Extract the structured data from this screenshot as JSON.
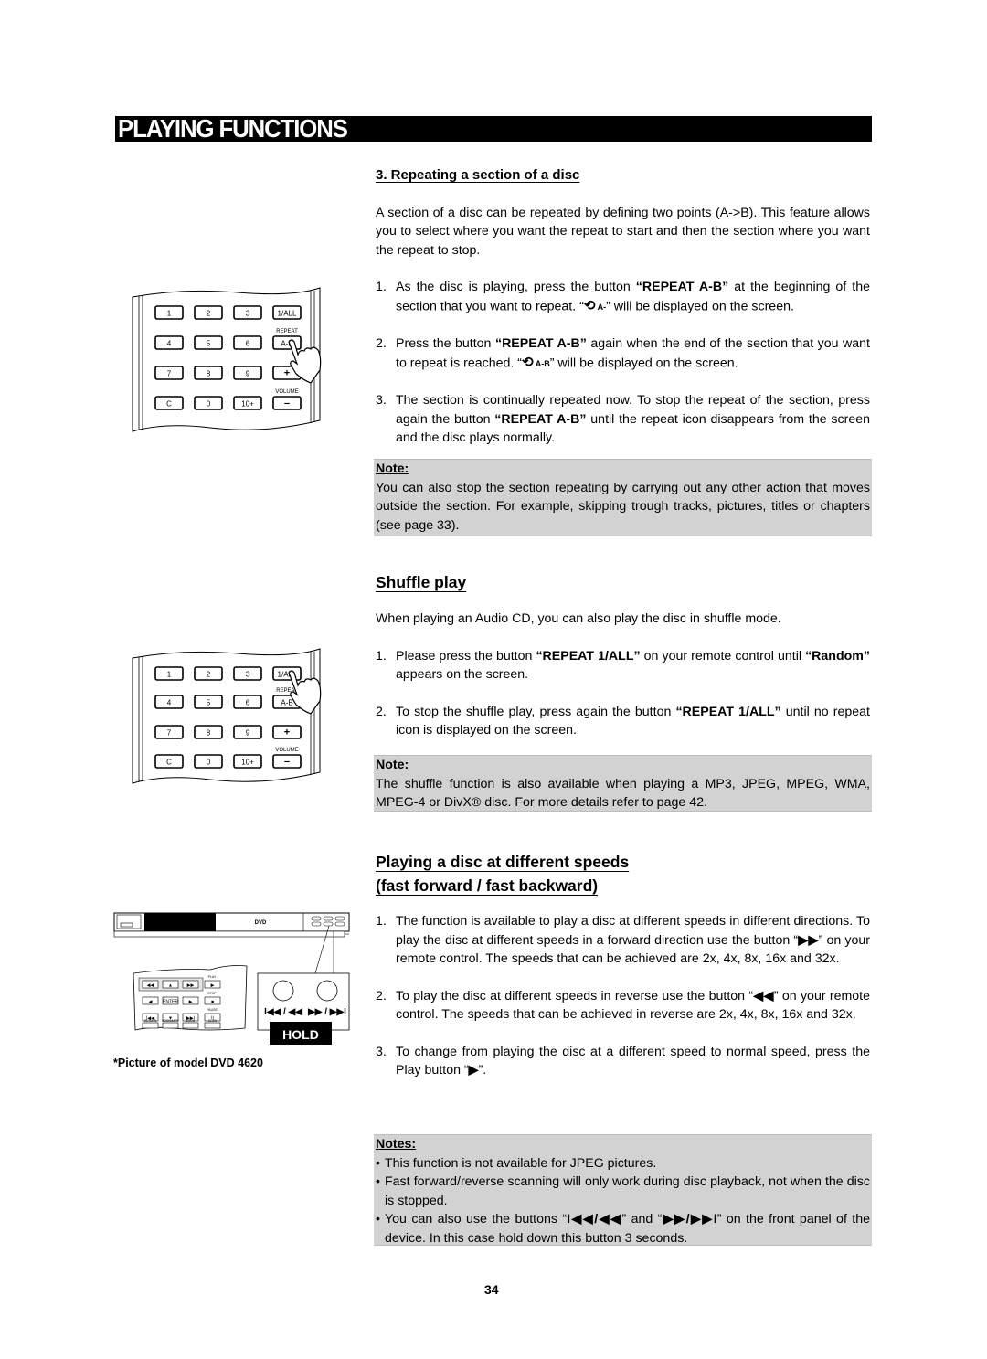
{
  "header": {
    "title": "PLAYING FUNCTIONS"
  },
  "section_repeat": {
    "heading": "3. Repeating a section of a disc",
    "intro": "A section of a disc can be repeated by defining two points (A->B). This feature allows you to select where you want the repeat to start and then the section where you want the repeat to stop.",
    "steps": [
      {
        "num": "1.",
        "pre": "As the disc is playing, press the button ",
        "bold": "“REPEAT A-B”",
        "post": " at the beginning of the section that you want to repeat. “",
        "icon_label": "A-",
        "tail": "” will be displayed on the screen."
      },
      {
        "num": "2.",
        "pre": "Press the button ",
        "bold": "“REPEAT A-B”",
        "post": " again when the end of the section that you want to repeat is reached. “",
        "icon_label": "A-B",
        "tail": "” will be displayed on the screen."
      },
      {
        "num": "3.",
        "pre": "The section is continually repeated now. To stop the repeat of the section, press again the button ",
        "bold": "“REPEAT A-B”",
        "post": " until the repeat icon disappears from the screen and the disc plays normally."
      }
    ],
    "repeat_icon": "repeat-icon",
    "note_label": "Note:",
    "note_text": "You can also stop the section repeating by carrying out any other action that moves outside the section. For example, skipping trough tracks, pictures, titles or chapters (see page 33)."
  },
  "section_shuffle": {
    "heading": "Shuffle play",
    "intro": "When playing an Audio CD, you can also play the disc in shuffle mode.",
    "steps": [
      {
        "num": "1.",
        "pre": "Please press the button ",
        "bold": "“REPEAT 1/ALL”",
        "post": " on your remote control until ",
        "bold2": "“Random”",
        "tail": " appears on the screen."
      },
      {
        "num": "2.",
        "pre": "To stop the shuffle play, press again the button ",
        "bold": "“REPEAT 1/ALL”",
        "post": " until no repeat icon is displayed on the screen."
      }
    ],
    "note_label": "Note:",
    "note_text": "The shuffle function is also available when playing a MP3, JPEG, MPEG, WMA, MPEG-4 or DivX® disc. For more details refer to page 42."
  },
  "section_speed": {
    "heading_line1": "Playing a disc at different speeds",
    "heading_line2": "(fast forward / fast backward)",
    "steps": [
      {
        "num": "1.",
        "pre": "The function is available to play a disc at different speeds in different directions. To play the disc at different speeds in a forward direction use the button “",
        "symbol": "▶▶",
        "post": "” on your remote control. The speeds that can be achieved are 2x, 4x, 8x, 16x and 32x."
      },
      {
        "num": "2.",
        "pre": "To play the disc at different speeds in reverse use the button “",
        "symbol": "◀◀",
        "post": "” on your remote control. The speeds that can be achieved in reverse are 2x, 4x, 8x, 16x and 32x."
      },
      {
        "num": "3.",
        "pre": "To change from playing the disc at a different speed to normal speed, press the Play button “",
        "symbol": "▶",
        "post": "”."
      }
    ],
    "notes_label": "Notes:",
    "notes": [
      "This function is not available for JPEG pictures.",
      "Fast forward/reverse scanning will only work during disc playback, not when the disc is stopped."
    ],
    "note3_pre": "You can also use the buttons “",
    "note3_sym1": "I◀◀/◀◀",
    "note3_mid": "” and “",
    "note3_sym2": "▶▶/▶▶I",
    "note3_post": "” on the front panel of the device. In this case hold down this button 3 seconds."
  },
  "remote_keypad": {
    "rows": [
      [
        "1",
        "2",
        "3",
        "1/ALL"
      ],
      [
        "4",
        "5",
        "6",
        "A-B"
      ],
      [
        "7",
        "8",
        "9",
        "+"
      ],
      [
        "C",
        "0",
        "10+",
        "–"
      ]
    ],
    "repeat_label": "REPEAT",
    "volume_label": "VOLUME"
  },
  "device_illustration": {
    "disc_logo": "DVD",
    "nav_keys": [
      "◀◀",
      "▲",
      "▶▶",
      "▶",
      "◀",
      "ENTER",
      "▶",
      "■",
      "I◀◀",
      "▼",
      "▶▶I",
      "II"
    ],
    "nav_labels": [
      "PLAY",
      "STOP",
      "PAUSE",
      "RETURN",
      "BOOKMARK",
      "ZOOM",
      "SLOW"
    ],
    "skip_back_label": "I◀◀ / ◀◀",
    "skip_fwd_label": "▶▶ / ▶▶I",
    "hold_label": "HOLD",
    "caption": "*Picture of model DVD 4620"
  },
  "footer": {
    "page_number": "34"
  }
}
